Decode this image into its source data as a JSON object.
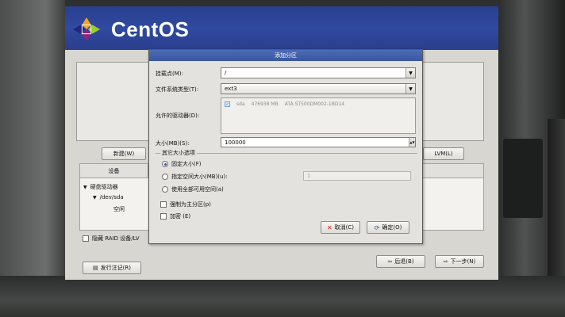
{
  "app": {
    "logo_text": "CentOS"
  },
  "main": {
    "new_button": "新建(W)",
    "lvm_button": "LVM(L)",
    "device_column": "设备",
    "tree": [
      "硬盘驱动器",
      "/dev/sda",
      "空闲"
    ],
    "hide_raid": "隐藏 RAID 设备/LV",
    "release_notes_button": "发行注记(R)",
    "back_button": "后退(B)",
    "next_button": "下一步(N)"
  },
  "dialog": {
    "title": "添加分区",
    "mount_label": "挂载点(M):",
    "mount_value": "/",
    "fs_label": "文件系统类型(T):",
    "fs_value": "ext3",
    "drives_label": "允许的驱动器(D):",
    "drive": {
      "name": "sda",
      "size": "476938 MB",
      "model": "ATA ST500DM002-1BD14"
    },
    "size_label": "大小(MB)(S):",
    "size_value": "100000",
    "other_options_title": "其它大小选项",
    "options": [
      "固定大小(F)",
      "指定空间大小(MB)(u):",
      "使用全部可用空间(a)"
    ],
    "fixed_size_value": "1",
    "force_primary": "强制为主分区(p)",
    "encrypt": "加密 (E)",
    "cancel_button": "取消(C)",
    "ok_button": "确定(O)"
  }
}
